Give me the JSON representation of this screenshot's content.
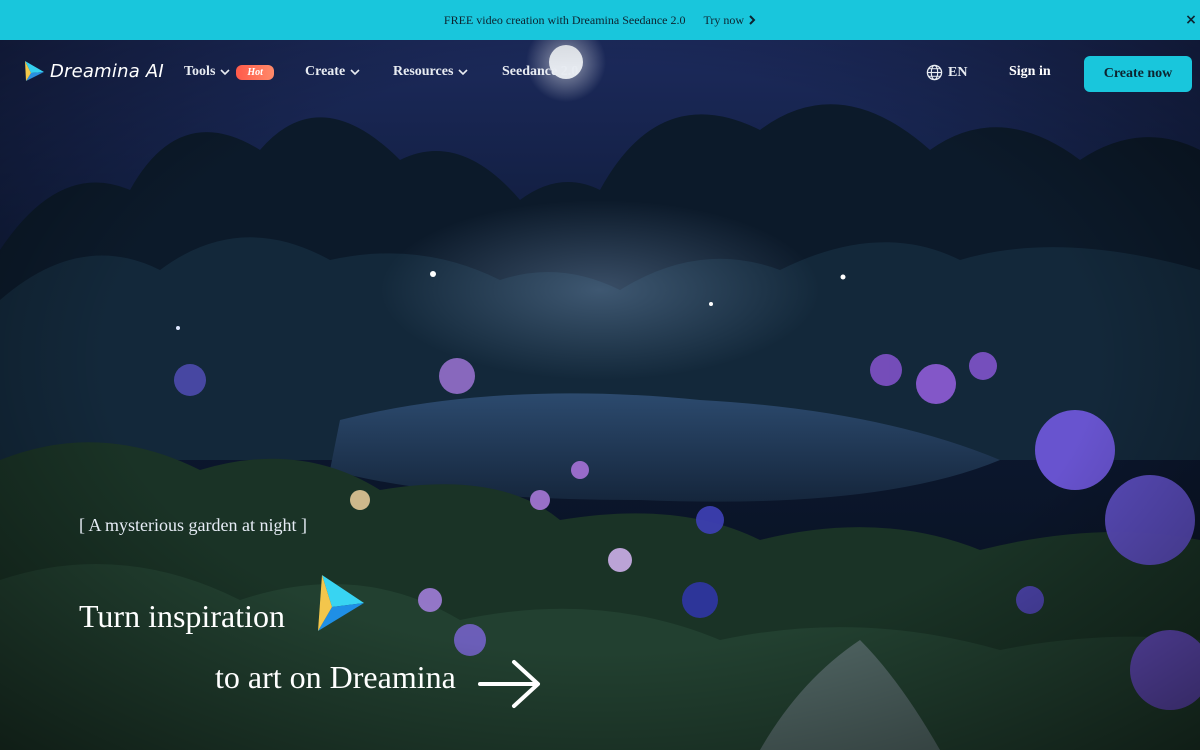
{
  "banner": {
    "text": "FREE video creation with Dreamina Seedance 2.0",
    "link_label": "Try now",
    "close_glyph": "×",
    "bg_color": "#19c6dc"
  },
  "nav": {
    "logo_text": "Dreamina AI",
    "items": [
      {
        "label": "Tools",
        "has_dropdown": true,
        "badge": "Hot"
      },
      {
        "label": "Create",
        "has_dropdown": true
      },
      {
        "label": "Resources",
        "has_dropdown": true
      },
      {
        "label": "Seedance 2.0",
        "has_dropdown": false
      }
    ],
    "language": "EN",
    "sign_in": "Sign in",
    "cta": "Create now"
  },
  "hero": {
    "caption": "[ A mysterious garden at night ]",
    "headline_line1": "Turn inspiration",
    "headline_line2": "to art on Dreamina",
    "icons": [
      "dreamina-spark-icon",
      "arrow-right-icon",
      "globe-icon",
      "chevron-down-icon"
    ],
    "accent_color": "#19c6dc"
  }
}
